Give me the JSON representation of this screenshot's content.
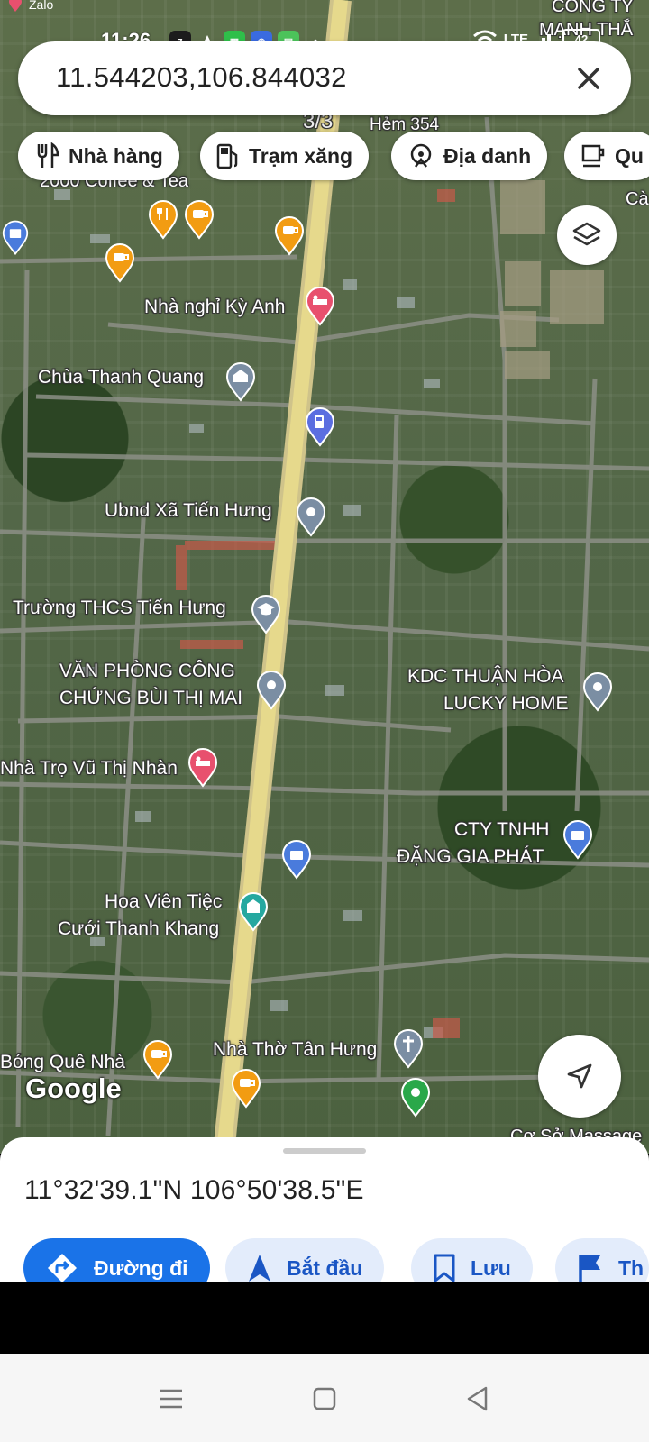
{
  "status_bar": {
    "time": "11:26",
    "notif_label": "Zalo",
    "battery": "42",
    "network": "LTE"
  },
  "search": {
    "query": "11.544203,106.844032"
  },
  "chips": [
    {
      "label": "Nhà hàng",
      "icon": "restaurant-icon"
    },
    {
      "label": "Trạm xăng",
      "icon": "gas-station-icon"
    },
    {
      "label": "Địa danh",
      "icon": "landmark-icon"
    },
    {
      "label": "Qu",
      "icon": "coffee-icon"
    }
  ],
  "map": {
    "top_labels": {
      "cong_ty_1": "CÔNG TY",
      "cong_ty_2": "MẠNH THẮ",
      "hem": "Hẻm 354",
      "page_indicator": "3/3",
      "coffee": "2000 Coffee & Tea",
      "cafe_edge": "Cà"
    },
    "places": [
      {
        "name": "Nhà nghỉ Kỳ Anh",
        "icon": "hotel-icon",
        "color": "#e8506e"
      },
      {
        "name": "Chùa Thanh Quang",
        "icon": "temple-icon",
        "color": "#7b8ea3"
      },
      {
        "name": "Ubnd Xã Tiến Hưng",
        "icon": "place-icon",
        "color": "#7b8ea3"
      },
      {
        "name": "Trường THCS Tiến Hưng",
        "icon": "school-icon",
        "color": "#7b8ea3"
      },
      {
        "name": "VĂN PHÒNG CÔNG",
        "icon": "place-icon",
        "color": "#7b8ea3"
      },
      {
        "name": "CHỨNG BÙI THỊ MAI",
        "icon": "",
        "color": ""
      },
      {
        "name": "KDC THUẬN HÒA",
        "icon": "place-icon",
        "color": "#7b8ea3"
      },
      {
        "name": "LUCKY HOME",
        "icon": "",
        "color": ""
      },
      {
        "name": "Nhà Trọ Vũ Thị Nhàn",
        "icon": "hotel-icon",
        "color": "#e8506e"
      },
      {
        "name": "CTY TNHH",
        "icon": "shopping-icon",
        "color": "#4a7bdc"
      },
      {
        "name": "ĐẶNG GIA PHÁT",
        "icon": "",
        "color": ""
      },
      {
        "name": "Hoa Viên Tiệc",
        "icon": "event-icon",
        "color": "#25a8a0"
      },
      {
        "name": "Cưới Thanh Khang",
        "icon": "",
        "color": ""
      },
      {
        "name": "Bóng Quê Nhà",
        "icon": "cafe-icon",
        "color": "#f29c12"
      },
      {
        "name": "Nhà Thờ Tân Hưng",
        "icon": "church-icon",
        "color": "#7b8ea3"
      },
      {
        "name": "Cơ Sở Massage",
        "icon": "",
        "color": ""
      }
    ],
    "logo": "Google"
  },
  "bottom_sheet": {
    "coordinates": "11°32'39.1\"N 106°50'38.5\"E",
    "actions": [
      {
        "label": "Đường đi",
        "icon": "directions-icon"
      },
      {
        "label": "Bắt đầu",
        "icon": "navigation-arrow-icon"
      },
      {
        "label": "Lưu",
        "icon": "bookmark-icon"
      },
      {
        "label": "Th",
        "icon": "flag-icon"
      }
    ]
  }
}
